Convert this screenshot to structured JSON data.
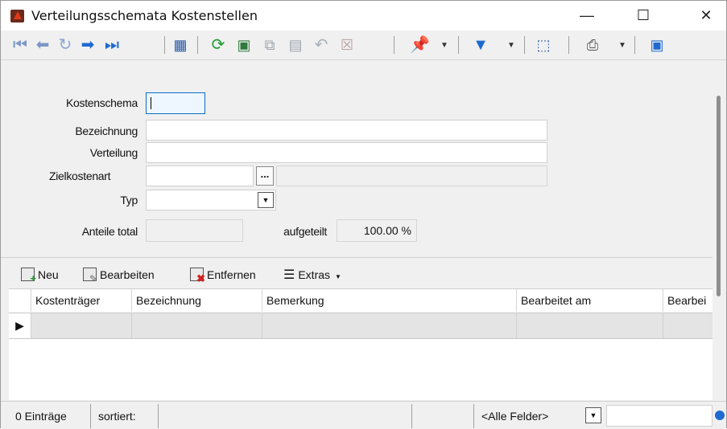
{
  "window": {
    "title": "Verteilungsschemata Kostenstellen",
    "controls": [
      "—",
      "☐",
      "✕"
    ]
  },
  "toolbar": {
    "icons": [
      "first-record-icon",
      "prev-record-icon",
      "history-icon",
      "next-record-icon",
      "last-record-icon",
      "table-view-icon",
      "refresh-icon",
      "new-record-icon",
      "copy-icon",
      "save-icon",
      "undo-icon",
      "delete-icon",
      "pin-icon",
      "filter-icon",
      "jump-icon",
      "print-icon",
      "layout-icon"
    ]
  },
  "form": {
    "kostenschema_label": "Kostenschema",
    "bezeichnung_label": "Bezeichnung",
    "verteilung_label": "Verteilung",
    "zielkostenart_label": "Zielkostenart",
    "typ_label": "Typ",
    "anteile_label": "Anteile total",
    "aufgeteilt_label": "aufgeteilt",
    "aufgeteilt_value": "100.00 %",
    "dots_label": "..."
  },
  "grid_toolbar": {
    "neu": "Neu",
    "bearbeiten": "Bearbeiten",
    "entfernen": "Entfernen",
    "extras": "Extras"
  },
  "grid": {
    "columns": [
      "Kostenträger",
      "Bezeichnung",
      "Bemerkung",
      "Bearbeitet am",
      "Bearbei"
    ],
    "rows": [
      {
        "marker": "▶",
        "cells": [
          "",
          "",
          "",
          "",
          ""
        ]
      }
    ]
  },
  "status": {
    "count": "0 Einträge",
    "sorted": "sortiert:",
    "field_filter": "<Alle Felder>"
  },
  "colors": {
    "accent": "#0a6cc4",
    "focus_border": "#0a6cc4",
    "row_bg": "#e4e4e4"
  }
}
